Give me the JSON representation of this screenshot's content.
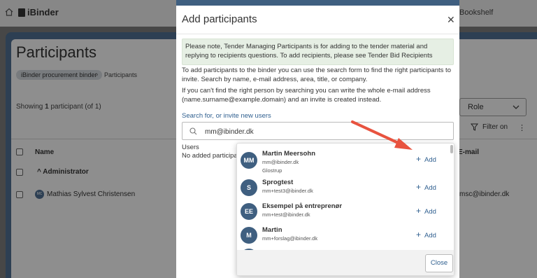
{
  "app": {
    "logo": "iBinder",
    "bookshelf": "Bookshelf",
    "page_title": "Participants",
    "breadcrumb": [
      "iBinder procurement binder",
      "Participants"
    ],
    "showing_prefix": "Showing ",
    "showing_count": "1",
    "showing_suffix": " participant (of 1)",
    "role_label": "Role",
    "role_select": "Role",
    "filter_label": "Filter on",
    "columns": {
      "name": "Name",
      "email": "E-mail"
    },
    "group": "Administrator",
    "row": {
      "initials": "MC",
      "name": "Mathias Sylvest Christensen",
      "email": "msc@ibinder.dk"
    }
  },
  "modal": {
    "title": "Add participants",
    "notice": "Please note, Tender Managing Participants is for adding to the tender material and replying to recipients questions. To add recipients, please see Tender Bid Recipients",
    "para1": "To add participants to the binder you can use the search form to find the right participants to invite. Search by name, e-mail address, area, title, or company.",
    "para2": "If you can't find the right person by searching you can write the whole e-mail address (name.surname@example.domain) and an invite is created instead.",
    "search_label": "Search for, or invite new users",
    "search_value": "mm@ibinder.dk",
    "users_label": "Users",
    "no_added": "No added participants"
  },
  "dropdown": {
    "add_label": "Add",
    "close_label": "Close",
    "items": [
      {
        "initials": "MM",
        "name": "Martin Meersohn",
        "email": "mm@ibinder.dk",
        "location": "Glostrup"
      },
      {
        "initials": "S",
        "name": "Sprogtest",
        "email": "mm+test3@ibinder.dk"
      },
      {
        "initials": "EE",
        "name": "Eksempel på entreprenør",
        "email": "mm+test@ibinder.dk"
      },
      {
        "initials": "M",
        "name": "Martin",
        "email": "mm+forslag@ibinder.dk"
      }
    ]
  },
  "colors": {
    "brand": "#3f5f80",
    "link": "#2f5f8f",
    "notice_bg": "#e6efe4",
    "arrow": "#e8533f"
  }
}
